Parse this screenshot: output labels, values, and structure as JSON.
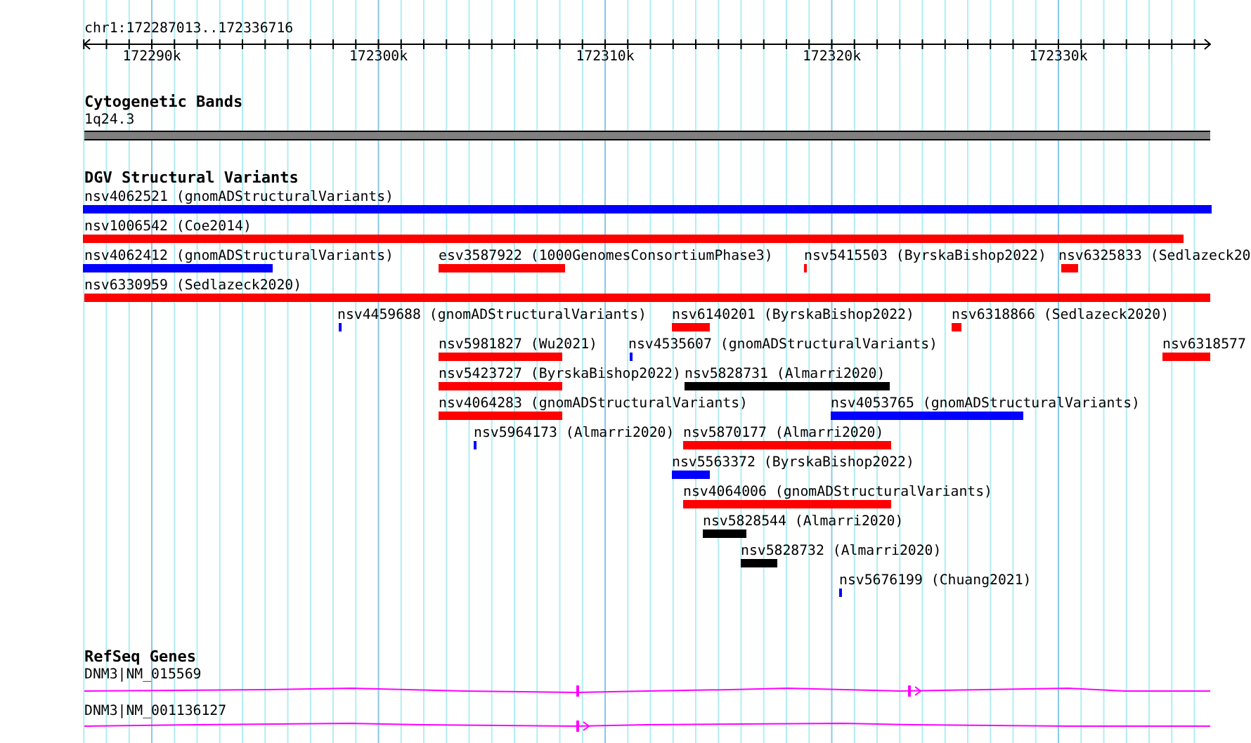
{
  "ruler": {
    "location": "chr1:172287013..172336716",
    "ticks": [
      "172290k",
      "172300k",
      "172310k",
      "172320k",
      "172330k"
    ]
  },
  "cytoband_track": {
    "title": "Cytogenetic Bands",
    "band": "1q24.3"
  },
  "dgv_track": {
    "title": "DGV Structural Variants",
    "features": [
      {
        "label": "nsv4062521 (gnomADStructuralVariants)",
        "color": "#0000ff"
      },
      {
        "label": "nsv1006542 (Coe2014)",
        "color": "#ff0000"
      },
      {
        "label": "nsv4062412 (gnomADStructuralVariants)",
        "color": "#0000ff"
      },
      {
        "label": "esv3587922 (1000GenomesConsortiumPhase3)",
        "color": "#ff0000"
      },
      {
        "label": "nsv5415503 (ByrskaBishop2022)",
        "color": "#ff0000"
      },
      {
        "label": "nsv6325833 (Sedlazeck20",
        "color": "#ff0000"
      },
      {
        "label": "nsv6330959 (Sedlazeck2020)",
        "color": "#ff0000"
      },
      {
        "label": "nsv4459688 (gnomADStructuralVariants)",
        "color": "#0000ff"
      },
      {
        "label": "nsv6140201 (ByrskaBishop2022)",
        "color": "#ff0000"
      },
      {
        "label": "nsv6318866 (Sedlazeck2020)",
        "color": "#ff0000"
      },
      {
        "label": "nsv5981827 (Wu2021)",
        "color": "#ff0000"
      },
      {
        "label": "nsv4535607 (gnomADStructuralVariants)",
        "color": "#0000ff"
      },
      {
        "label": "nsv6318577",
        "color": "#ff0000"
      },
      {
        "label": "nsv5423727 (ByrskaBishop2022)",
        "color": "#ff0000"
      },
      {
        "label": "nsv5828731 (Almarri2020)",
        "color": "#000000"
      },
      {
        "label": "nsv4064283 (gnomADStructuralVariants)",
        "color": "#ff0000"
      },
      {
        "label": "nsv4053765 (gnomADStructuralVariants)",
        "color": "#0000ff"
      },
      {
        "label": "nsv5964173 (Almarri2020)",
        "color": "#0000ff"
      },
      {
        "label": "nsv5870177 (Almarri2020)",
        "color": "#ff0000"
      },
      {
        "label": "nsv5563372 (ByrskaBishop2022)",
        "color": "#0000ff"
      },
      {
        "label": "nsv4064006 (gnomADStructuralVariants)",
        "color": "#ff0000"
      },
      {
        "label": "nsv5828544 (Almarri2020)",
        "color": "#000000"
      },
      {
        "label": "nsv5828732 (Almarri2020)",
        "color": "#000000"
      },
      {
        "label": "nsv5676199 (Chuang2021)",
        "color": "#0000ff"
      }
    ]
  },
  "refseq_track": {
    "title": "RefSeq Genes",
    "transcripts": [
      "DNM3|NM_015569",
      "DNM3|NM_001136127"
    ]
  }
}
